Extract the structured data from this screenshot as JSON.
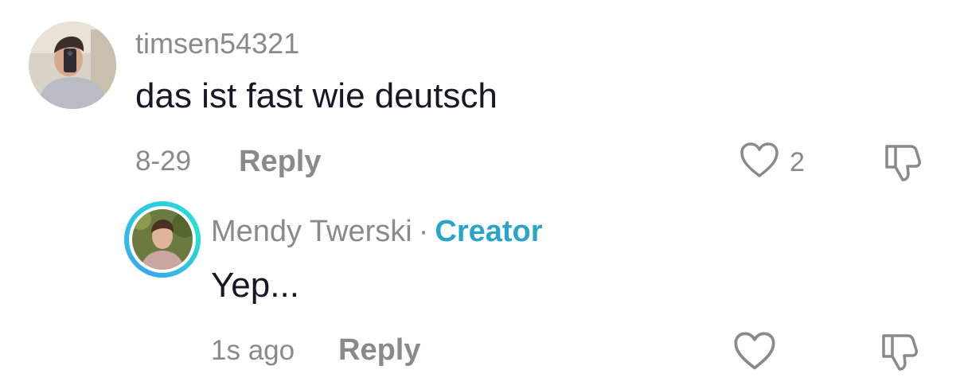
{
  "comments": [
    {
      "username": "timsen54321",
      "text": "das ist fast wie deutsch",
      "date": "8-29",
      "reply_label": "Reply",
      "like_count": "2",
      "avatar_icon": "user-photo-avatar"
    }
  ],
  "reply": {
    "username": "Mendy Twerski",
    "separator": "·",
    "badge": "Creator",
    "text": "Yep...",
    "date": "1s ago",
    "reply_label": "Reply",
    "avatar_icon": "creator-photo-avatar"
  },
  "colors": {
    "meta_gray": "#8a8a8a",
    "text_dark": "#161823",
    "creator_accent": "#2aa5c9",
    "ring_gradient_start": "#3aa6f0",
    "ring_gradient_end": "#27e0d0"
  },
  "icons": {
    "like": "heart-outline-icon",
    "dislike": "thumbs-down-outline-icon"
  }
}
